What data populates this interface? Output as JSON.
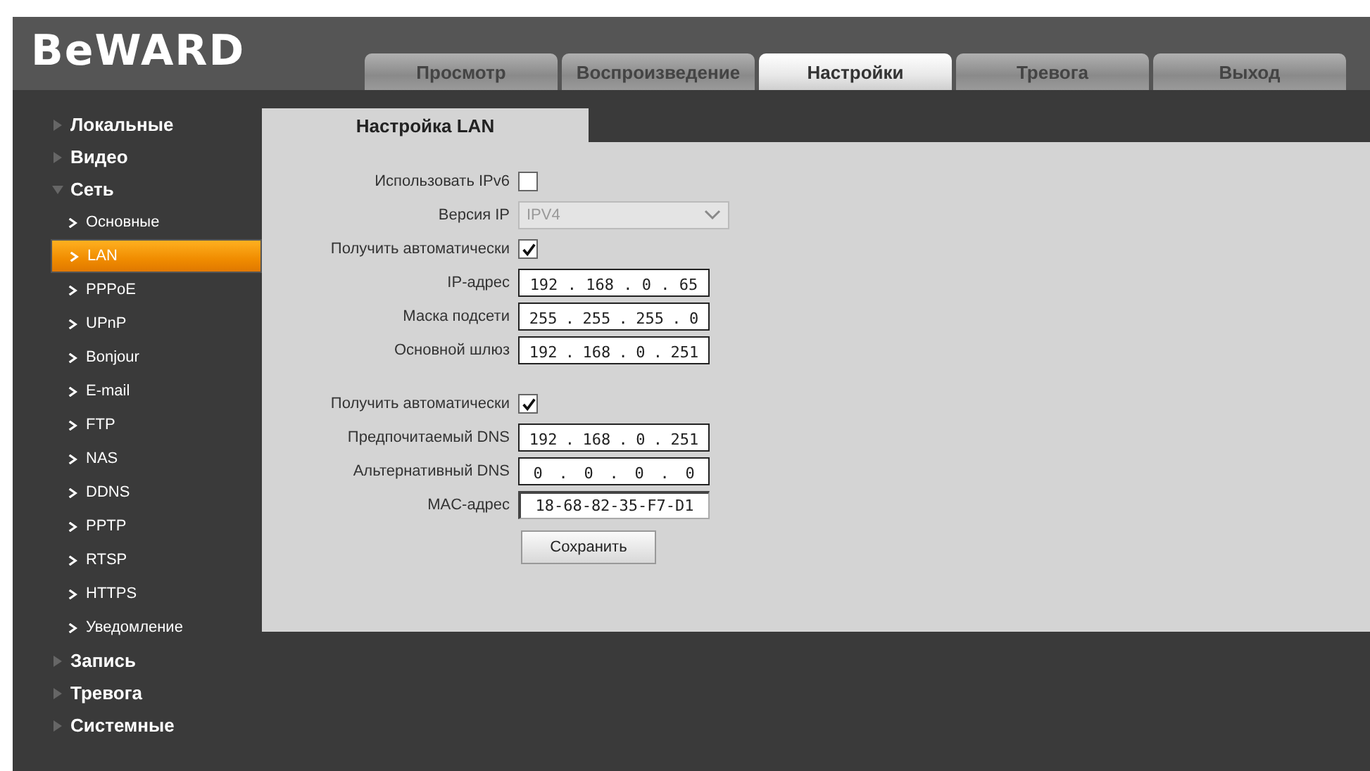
{
  "logo": "BeWARD",
  "tabs": [
    {
      "label": "Просмотр",
      "selected": false
    },
    {
      "label": "Воспроизведение",
      "selected": false
    },
    {
      "label": "Настройки",
      "selected": true
    },
    {
      "label": "Тревога",
      "selected": false
    },
    {
      "label": "Выход",
      "selected": false
    }
  ],
  "sidebar": {
    "items": [
      {
        "label": "Локальные",
        "expanded": false
      },
      {
        "label": "Видео",
        "expanded": false
      },
      {
        "label": "Сеть",
        "expanded": true,
        "children": [
          {
            "label": "Основные",
            "selected": false
          },
          {
            "label": "LAN",
            "selected": true
          },
          {
            "label": "PPPoE",
            "selected": false
          },
          {
            "label": "UPnP",
            "selected": false
          },
          {
            "label": "Bonjour",
            "selected": false
          },
          {
            "label": "E-mail",
            "selected": false
          },
          {
            "label": "FTP",
            "selected": false
          },
          {
            "label": "NAS",
            "selected": false
          },
          {
            "label": "DDNS",
            "selected": false
          },
          {
            "label": "PPTP",
            "selected": false
          },
          {
            "label": "RTSP",
            "selected": false
          },
          {
            "label": "HTTPS",
            "selected": false
          },
          {
            "label": "Уведомление",
            "selected": false
          }
        ]
      },
      {
        "label": "Запись",
        "expanded": false
      },
      {
        "label": "Тревога",
        "expanded": false
      },
      {
        "label": "Системные",
        "expanded": false
      }
    ]
  },
  "panel": {
    "title": "Настройка LAN",
    "rows": [
      {
        "kind": "checkbox",
        "label": "Использовать IPv6",
        "checked": false
      },
      {
        "kind": "select",
        "label": "Версия IP",
        "value": "IPV4",
        "disabled": true
      },
      {
        "kind": "checkbox",
        "label": "Получить автоматически",
        "checked": true
      },
      {
        "kind": "ip",
        "label": "IP-адрес",
        "octets": [
          "192",
          "168",
          "0",
          "65"
        ]
      },
      {
        "kind": "ip",
        "label": "Маска подсети",
        "octets": [
          "255",
          "255",
          "255",
          "0"
        ]
      },
      {
        "kind": "ip",
        "label": "Основной шлюз",
        "octets": [
          "192",
          "168",
          "0",
          "251"
        ]
      },
      {
        "kind": "gap"
      },
      {
        "kind": "checkbox",
        "label": "Получить автоматически",
        "checked": true
      },
      {
        "kind": "ip",
        "label": "Предпочитаемый DNS",
        "octets": [
          "192",
          "168",
          "0",
          "251"
        ]
      },
      {
        "kind": "ip",
        "label": "Альтернативный DNS",
        "octets": [
          "0",
          "0",
          "0",
          "0"
        ]
      },
      {
        "kind": "text",
        "label": "MAC-адрес",
        "value": "18-68-82-35-F7-D1"
      }
    ],
    "separator": ".",
    "save_button": "Сохранить"
  }
}
